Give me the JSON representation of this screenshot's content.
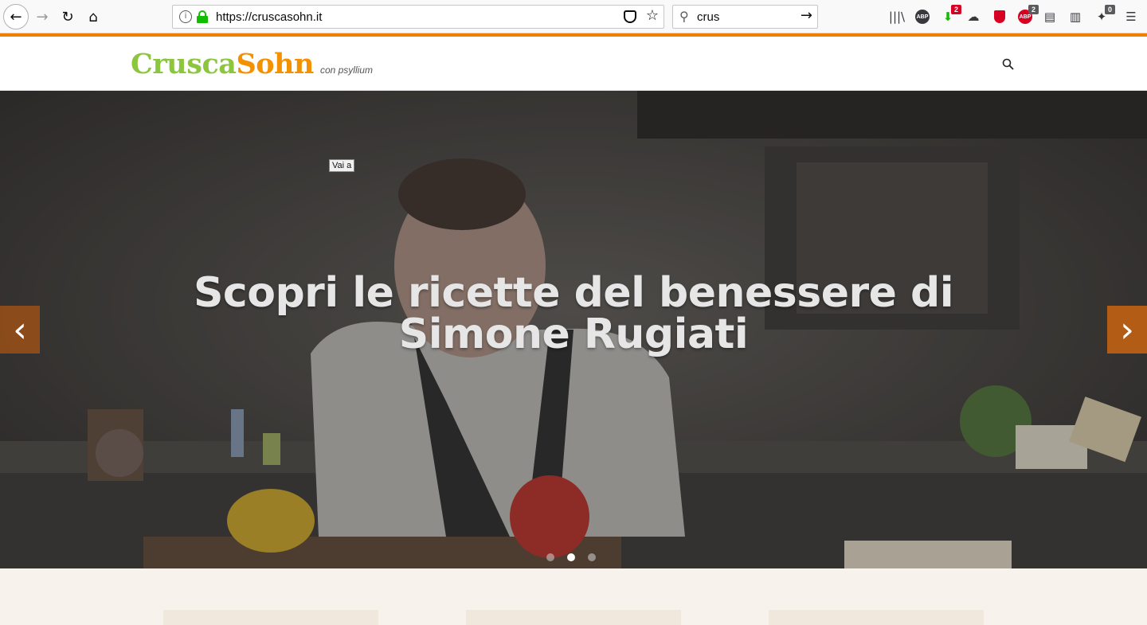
{
  "browser": {
    "url": "https://cruscasohn.it",
    "search_value": "crus",
    "badges": {
      "download": "2",
      "abp": "2",
      "extension": "0"
    },
    "colors": {
      "lock": "#12bc00",
      "accent_line": "#ee7f00"
    }
  },
  "site": {
    "logo_part1": "Crusca",
    "logo_part2": "Sohn",
    "tagline": "con psyllium",
    "colors": {
      "logo_green": "#8cc63f",
      "logo_orange": "#f39200"
    }
  },
  "hero": {
    "title_line1": "Scopri le ricette del benessere di",
    "title_line2": "Simone Rugiati",
    "active_slide": 2,
    "slide_count": 3,
    "tooltip": "Vai a"
  },
  "icons": {
    "back": "back-arrow-icon",
    "forward": "forward-arrow-icon",
    "reload": "reload-icon",
    "home": "home-icon",
    "site_search": "search-icon",
    "prev": "chevron-left-icon",
    "next": "chevron-right-icon"
  }
}
